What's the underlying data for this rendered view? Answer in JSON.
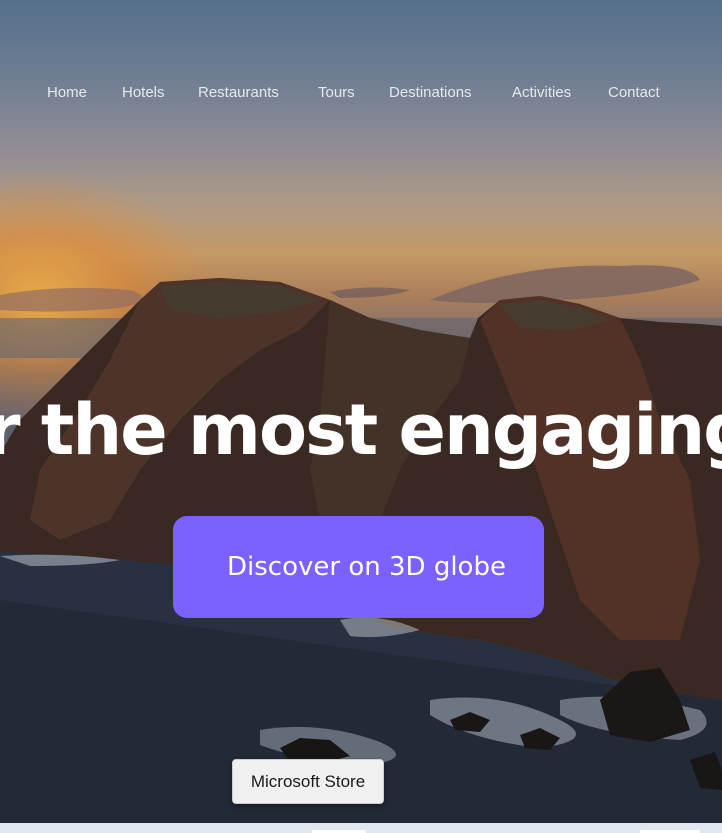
{
  "nav": {
    "items": [
      {
        "label": "Home"
      },
      {
        "label": "Hotels"
      },
      {
        "label": "Restaurants"
      },
      {
        "label": "Tours"
      },
      {
        "label": "Destinations"
      },
      {
        "label": "Activities"
      },
      {
        "label": "Contact"
      }
    ]
  },
  "hero": {
    "headline": "r the most engaging",
    "cta_label": "Discover on 3D globe"
  },
  "tooltip": {
    "text": "Microsoft Store"
  },
  "colors": {
    "accent": "#7b62ff",
    "nav_text": "#ffffff",
    "headline": "#ffffff",
    "tooltip_bg": "#f0f0f0"
  }
}
